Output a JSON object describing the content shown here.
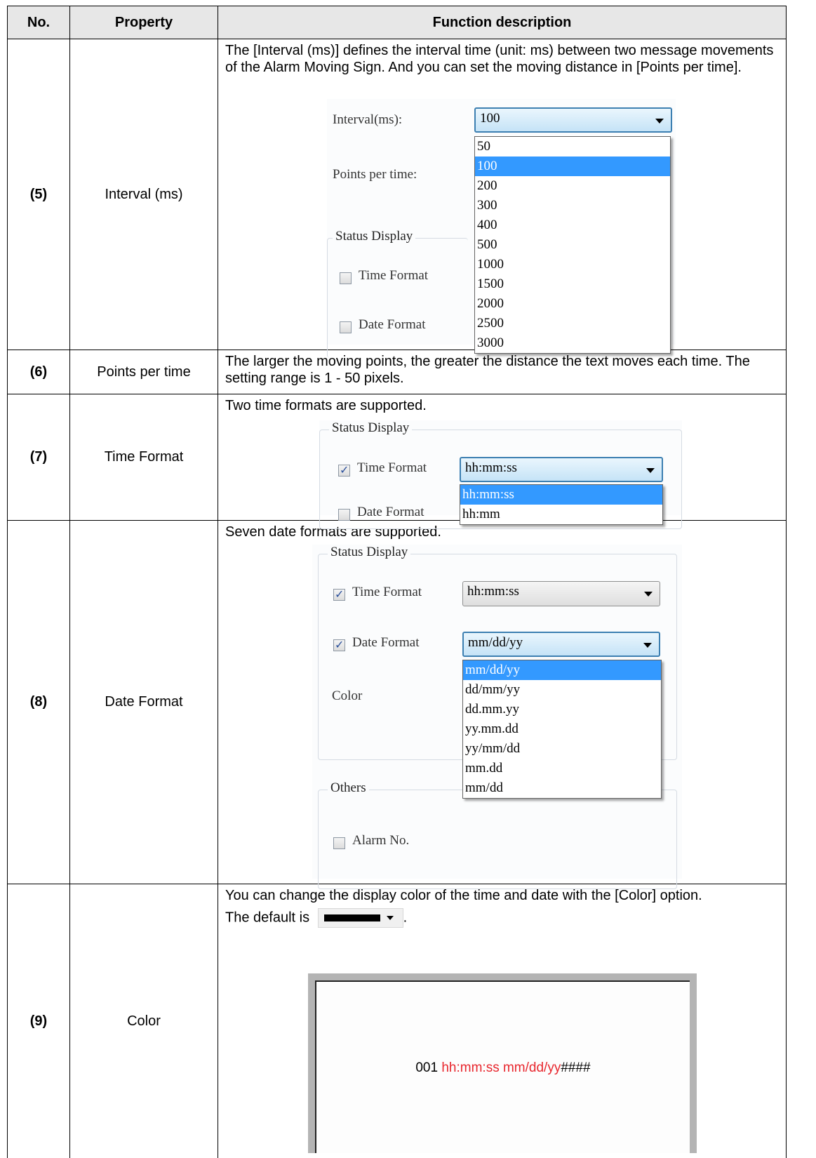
{
  "table": {
    "headers": [
      "No.",
      "Property",
      "Function description"
    ],
    "rows": [
      {
        "no": "(5)",
        "property": "Interval (ms)",
        "description": "The [Interval (ms)] defines the interval time (unit: ms) between two message movements of the Alarm Moving Sign. And you can set the moving distance in [Points per time].",
        "snapshot": {
          "interval_label": "Interval(ms):",
          "points_label": "Points per time:",
          "group_title": "Status Display",
          "time_format_label": "Time Format",
          "date_format_label": "Date Format",
          "combo_value": "100",
          "options": [
            "50",
            "100",
            "200",
            "300",
            "400",
            "500",
            "1000",
            "1500",
            "2000",
            "2500",
            "3000"
          ],
          "selected": "100"
        }
      },
      {
        "no": "(6)",
        "property": "Points per time",
        "description": "The larger the moving points, the greater the distance the text moves each time. The setting range is 1 - 50 pixels."
      },
      {
        "no": "(7)",
        "property": "Time Format",
        "description": "Two time formats are supported.",
        "snapshot": {
          "group_title": "Status Display",
          "time_format_label": "Time Format",
          "date_format_label": "Date Format",
          "time_checked": true,
          "combo_value": "hh:mm:ss",
          "options": [
            "hh:mm:ss",
            "hh:mm"
          ],
          "selected": "hh:mm:ss"
        }
      },
      {
        "no": "(8)",
        "property": "Date Format",
        "description": "Seven date formats are supported.",
        "snapshot": {
          "group_title": "Status Display",
          "time_format_label": "Time Format",
          "time_combo_value": "hh:mm:ss",
          "date_format_label": "Date Format",
          "date_combo_value": "mm/dd/yy",
          "color_label": "Color",
          "others_title": "Others",
          "alarm_no_label": "Alarm No.",
          "options": [
            "mm/dd/yy",
            "dd/mm/yy",
            "dd.mm.yy",
            "yy.mm.dd",
            "yy/mm/dd",
            "mm.dd",
            "mm/dd"
          ],
          "selected": "mm/dd/yy"
        }
      },
      {
        "no": "(9)",
        "property": "Color",
        "description": "You can change the display color of the time and date with the [Color] option.",
        "default_text": "The default is",
        "default_color": "#000000",
        "preview": {
          "alarm_no": "001",
          "time": "hh:mm:ss",
          "date": "mm/dd/yy",
          "message": "####",
          "highlight_color": "#e8262d"
        }
      }
    ]
  }
}
